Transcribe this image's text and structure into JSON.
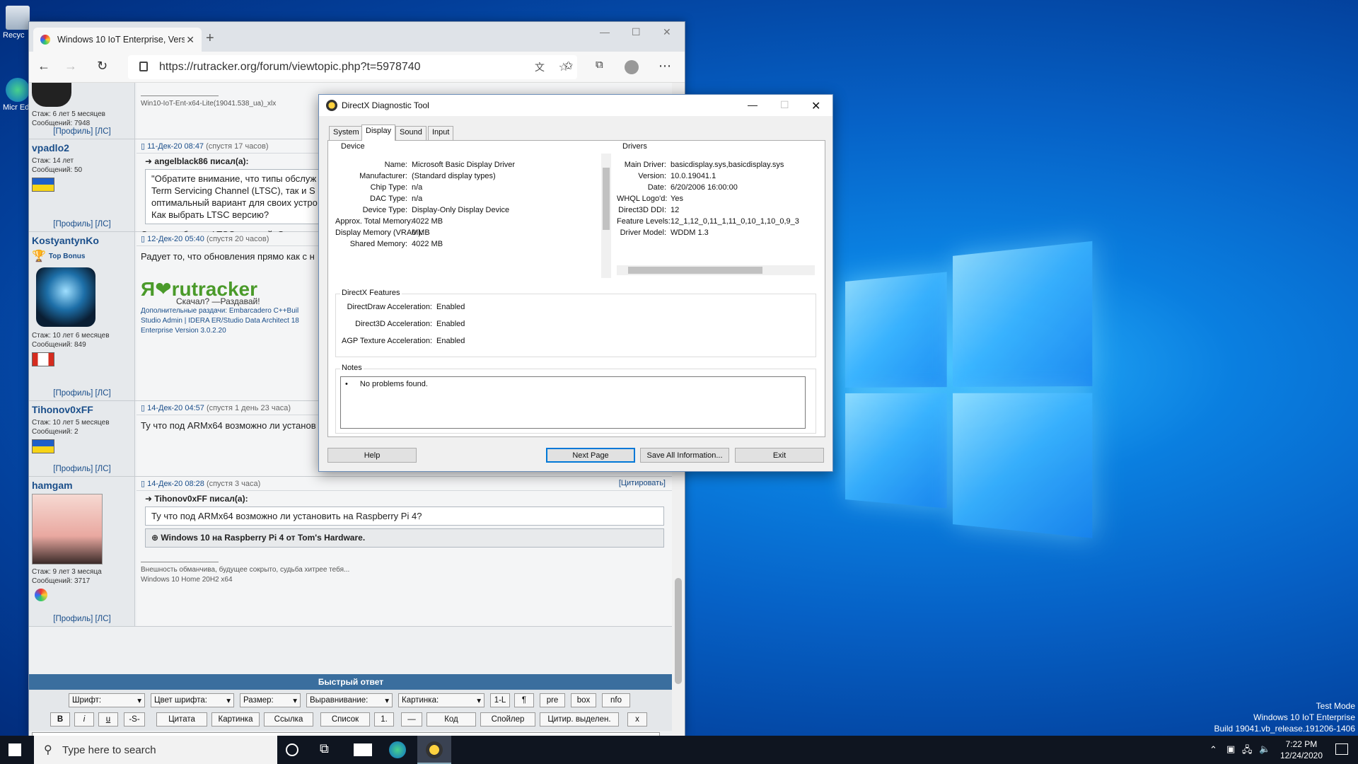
{
  "desktop": {
    "icons": [
      {
        "label": "Recyc"
      },
      {
        "label": "Micr Ed"
      }
    ],
    "watermark": {
      "line1": "Test Mode",
      "line2": "Windows 10 IoT Enterprise",
      "line3": "Build 19041.vb_release.191206-1406"
    }
  },
  "browser": {
    "tab_title": "Windows 10 IoT Enterprise, Versi",
    "tab_close": "✕",
    "new_tab": "+",
    "url": "https://rutracker.org/forum/viewtopic.php?t=5978740",
    "controls": {
      "minimize": "—",
      "maximize": "☐",
      "close": "✕"
    }
  },
  "forum": {
    "top_sig": "Win10-IoT-Ent-x64-Lite(19041.538_ua)_xlx",
    "top_user_stats": [
      "Стаж: 6 лет 5 месяцев",
      "Сообщений: 7948"
    ],
    "profile_links": "[Профиль]  [ЛС]",
    "posts": [
      {
        "user": "vpadlo2",
        "stats": [
          "Стаж: 14 лет",
          "Сообщений: 50"
        ],
        "date": "11-Дек-20 08:47",
        "after": "(спустя 17 часов)",
        "quote_author": "angelblack86 писал(а):",
        "quote_lines": [
          "\"Обратите внимание, что типы обслуж",
          "Term Servicing Channel (LTSC), так и S",
          "оптимальный вариант для своих устро",
          "Как выбрать LTSC версию?"
        ],
        "text": "Скачать образ с LTSC версией. Это отдел"
      },
      {
        "user": "KostyantynKo",
        "badge": "Top Bonus",
        "stats": [
          "Стаж: 10 лет 6 месяцев",
          "Сообщений: 849"
        ],
        "date": "12-Дек-20 05:40",
        "after": "(спустя 20 часов)",
        "text": "Радует то, что обновления прямо как с н",
        "logo_text": "Я❤rutracker",
        "logo_sub": "Скачал? —Раздавай!",
        "sig_lines": [
          "Дополнительные раздачи: Embarcadero C++Buil",
          "Studio Admin | IDERA ER/Studio Data Architect 18",
          "Enterprise Version 3.0.2.20"
        ]
      },
      {
        "user": "Tihonov0xFF",
        "stats": [
          "Стаж: 10 лет 5 месяцев",
          "Сообщений: 2"
        ],
        "date": "14-Дек-20 04:57",
        "after": "(спустя 1 день 23 часа)",
        "text": "Ту что под ARMx64 возможно ли установ"
      },
      {
        "user": "hamgam",
        "stats": [
          "Стаж: 9 лет 3 месяца",
          "Сообщений: 3717"
        ],
        "date": "14-Дек-20 08:28",
        "after": "(спустя 3 часа)",
        "quote_btn": "[Цитировать]",
        "quote_author": "Tihonov0xFF писал(а):",
        "quote_text": "Ту что под ARMx64 возможно ли установить на Raspberry Pi 4?",
        "link_title": "Windows 10 на Raspberry Pi 4 от Tom's Hardware.",
        "sig_lines": [
          "Внешность обманчива, будущее сокрыто, судьба хитрее тебя...",
          "Windows 10 Home 20H2 x64"
        ]
      }
    ],
    "quick_reply": "Быстрый ответ",
    "toolbar1": [
      "Шрифт:",
      "Цвет шрифта:",
      "Размер:",
      "Выравнивание:",
      "Картинка:"
    ],
    "toolbar1_btns": [
      "1-L",
      "¶",
      "pre",
      "box",
      "nfo"
    ],
    "toolbar2": [
      "B",
      "i",
      "u",
      "-S-",
      "Цитата",
      "Картинка",
      "Ссылка",
      "Список",
      "1.",
      "—",
      "Код",
      "Спойлер",
      "Цитир. выделен.",
      "x"
    ]
  },
  "dxdiag": {
    "title": "DirectX Diagnostic Tool",
    "tabs": [
      "System",
      "Display",
      "Sound",
      "Input"
    ],
    "device_title": "Device",
    "device": [
      {
        "label": "Name:",
        "value": "Microsoft Basic Display Driver"
      },
      {
        "label": "Manufacturer:",
        "value": "(Standard display types)"
      },
      {
        "label": "Chip Type:",
        "value": "n/a"
      },
      {
        "label": "DAC Type:",
        "value": "n/a"
      },
      {
        "label": "Device Type:",
        "value": "Display-Only Display Device"
      },
      {
        "label": "Approx. Total Memory:",
        "value": "4022 MB"
      },
      {
        "label": "Display Memory (VRAM):",
        "value": "0 MB"
      },
      {
        "label": "Shared Memory:",
        "value": "4022 MB"
      }
    ],
    "drivers_title": "Drivers",
    "drivers": [
      {
        "label": "Main Driver:",
        "value": "basicdisplay.sys,basicdisplay.sys"
      },
      {
        "label": "Version:",
        "value": "10.0.19041.1"
      },
      {
        "label": "Date:",
        "value": "6/20/2006 16:00:00"
      },
      {
        "label": "WHQL Logo'd:",
        "value": "Yes"
      },
      {
        "label": "Direct3D DDI:",
        "value": "12"
      },
      {
        "label": "Feature Levels:",
        "value": "12_1,12_0,11_1,11_0,10_1,10_0,9_3"
      },
      {
        "label": "Driver Model:",
        "value": "WDDM 1.3"
      }
    ],
    "features_title": "DirectX Features",
    "features": [
      {
        "label": "DirectDraw Acceleration:",
        "value": "Enabled"
      },
      {
        "label": "Direct3D Acceleration:",
        "value": "Enabled"
      },
      {
        "label": "AGP Texture Acceleration:",
        "value": "Enabled"
      }
    ],
    "notes_title": "Notes",
    "notes": "No problems found.",
    "buttons": {
      "help": "Help",
      "next": "Next Page",
      "save": "Save All Information...",
      "exit": "Exit"
    }
  },
  "taskbar": {
    "search_placeholder": "Type here to search",
    "time": "7:22 PM",
    "date": "12/24/2020"
  }
}
